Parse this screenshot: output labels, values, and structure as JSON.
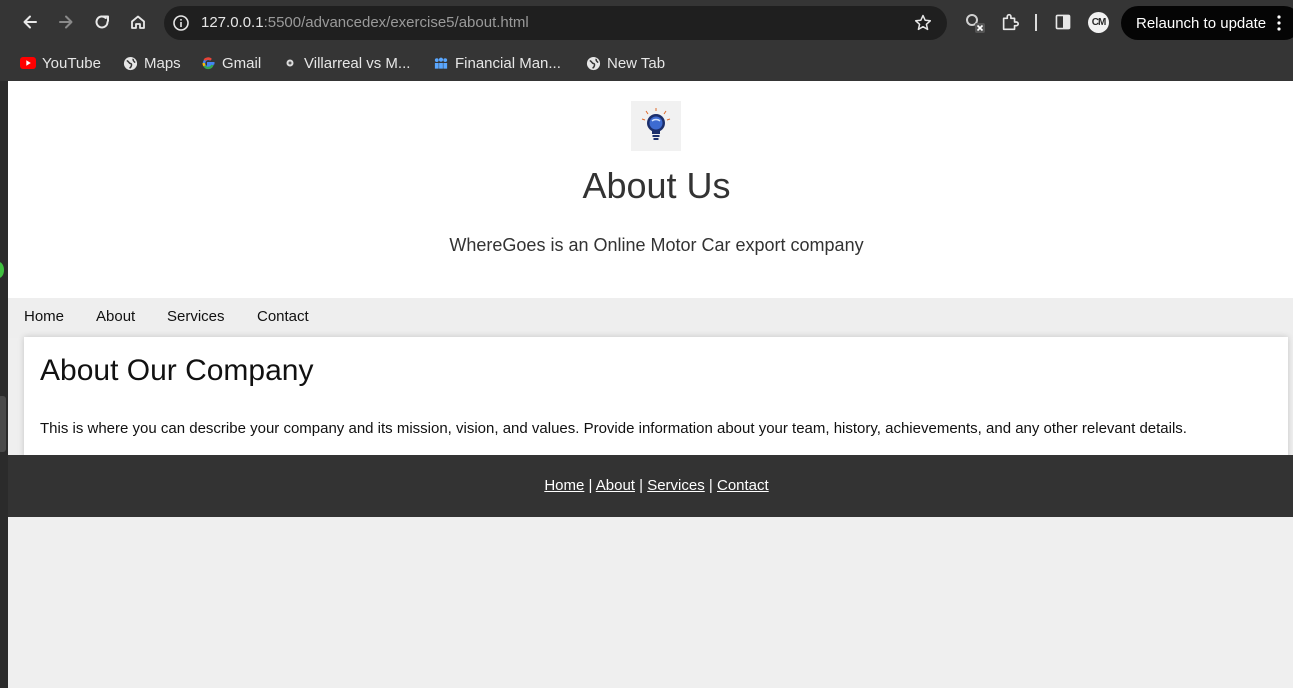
{
  "browser": {
    "url_host": "127.0.0.1",
    "url_rest": ":5500/advancedex/exercise5/about.html",
    "relaunch_label": "Relaunch to update",
    "avatar_initials": "CM",
    "icons": [
      "back-icon",
      "forward-icon",
      "reload-icon",
      "home-icon",
      "site-info-icon",
      "bookmark-star-icon",
      "extension-badge-icon",
      "puzzle-icon",
      "side-panel-icon",
      "menu-dots-icon"
    ]
  },
  "bookmarks": [
    {
      "label": "YouTube",
      "icon": "youtube-icon"
    },
    {
      "label": "Maps",
      "icon": "globe-icon"
    },
    {
      "label": "Gmail",
      "icon": "google-icon"
    },
    {
      "label": "Villarreal vs M...",
      "icon": "soccer-icon"
    },
    {
      "label": "Financial Man...",
      "icon": "people-icon"
    },
    {
      "label": "New Tab",
      "icon": "globe-icon"
    }
  ],
  "header": {
    "logo_icon": "lightbulb-logo",
    "title": "About Us",
    "subtitle": "WhereGoes is an Online Motor Car export company"
  },
  "nav": {
    "items": [
      {
        "label": "Home"
      },
      {
        "label": "About"
      },
      {
        "label": "Services"
      },
      {
        "label": "Contact"
      }
    ]
  },
  "main": {
    "heading": "About Our Company",
    "body": "This is where you can describe your company and its mission, vision, and values. Provide information about your team, history, achievements, and any other relevant details."
  },
  "footer": {
    "links": [
      {
        "label": "Home"
      },
      {
        "label": "About"
      },
      {
        "label": "Services"
      },
      {
        "label": "Contact"
      }
    ],
    "separator": "|"
  },
  "colors": {
    "chrome_bg": "#353535",
    "omnibox_bg": "#1f1f1f",
    "page_bg": "#efefef",
    "header_bg": "#ffffff",
    "footer_bg": "#333333",
    "text": "#333333"
  }
}
